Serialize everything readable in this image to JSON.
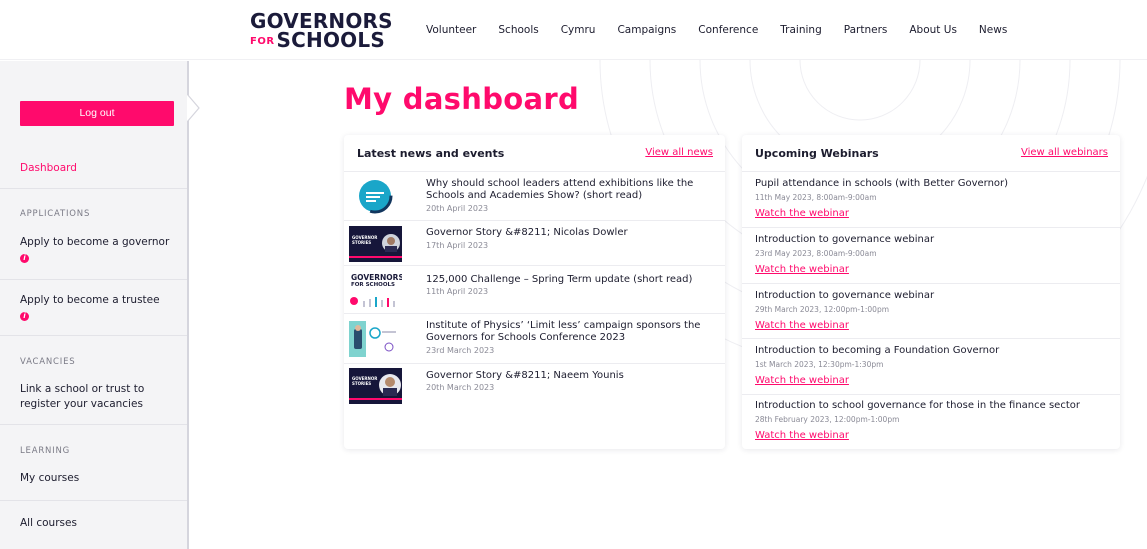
{
  "logo": {
    "line1": "GOVERNORS",
    "for": "FOR",
    "line2": "SCHOOLS"
  },
  "nav": [
    "Volunteer",
    "Schools",
    "Cymru",
    "Campaigns",
    "Conference",
    "Training",
    "Partners",
    "About Us",
    "News"
  ],
  "sidebar": {
    "logout": "Log out",
    "dashboard": "Dashboard",
    "applications_heading": "APPLICATIONS",
    "apply_governor": "Apply to become a governor",
    "apply_trustee": "Apply to become a trustee",
    "vacancies_heading": "VACANCIES",
    "link_school_1": "Link a school or trust to",
    "link_school_2": "register your vacancies",
    "learning_heading": "LEARNING",
    "my_courses": "My courses",
    "all_courses": "All courses",
    "info_glyph": "i"
  },
  "page": {
    "title": "My dashboard"
  },
  "news": {
    "title": "Latest news and events",
    "view_all": "View all news",
    "items": [
      {
        "line1": "Why should school leaders attend exhibitions like the",
        "line2": "Schools and Academies Show? (short read)",
        "date": "20th April 2023"
      },
      {
        "line1": "Governor Story &#8211; Nicolas Dowler",
        "line2": "",
        "date": "17th April 2023"
      },
      {
        "line1": "125,000 Challenge – Spring Term update (short read)",
        "line2": "",
        "date": "11th April 2023"
      },
      {
        "line1": "Institute of Physics’ ‘Limit less’ campaign sponsors the",
        "line2": "Governors for Schools Conference 2023",
        "date": "23rd March 2023"
      },
      {
        "line1": "Governor Story &#8211; Naeem Younis",
        "line2": "",
        "date": "20th March 2023"
      }
    ],
    "thumb_labels": {
      "governor_stories": "GOVERNOR STORIES",
      "gfs_1": "GOVERNORS",
      "gfs_2": "FOR SCHOOLS"
    }
  },
  "webinars": {
    "title": "Upcoming Webinars",
    "view_all": "View all webinars",
    "items": [
      {
        "title": "Pupil attendance in schools (with Better Governor)",
        "date": "11th May 2023, 8:00am-9:00am",
        "link": "Watch the webinar"
      },
      {
        "title": "Introduction to governance webinar",
        "date": "23rd May 2023, 8:00am-9:00am",
        "link": "Watch the webinar"
      },
      {
        "title": "Introduction to governance webinar",
        "date": "29th March 2023, 12:00pm-1:00pm",
        "link": "Watch the webinar"
      },
      {
        "title": "Introduction to becoming a Foundation Governor",
        "date": "1st March 2023, 12:30pm-1:30pm",
        "link": "Watch the webinar"
      },
      {
        "title": "Introduction to school governance for those in the finance sector",
        "date": "28th February 2023, 12:00pm-1:00pm",
        "link": "Watch the webinar"
      }
    ]
  },
  "colors": {
    "accent": "#ff0a6c",
    "navy": "#1b1b3a",
    "sidebar_bg": "#f4f4f6"
  }
}
